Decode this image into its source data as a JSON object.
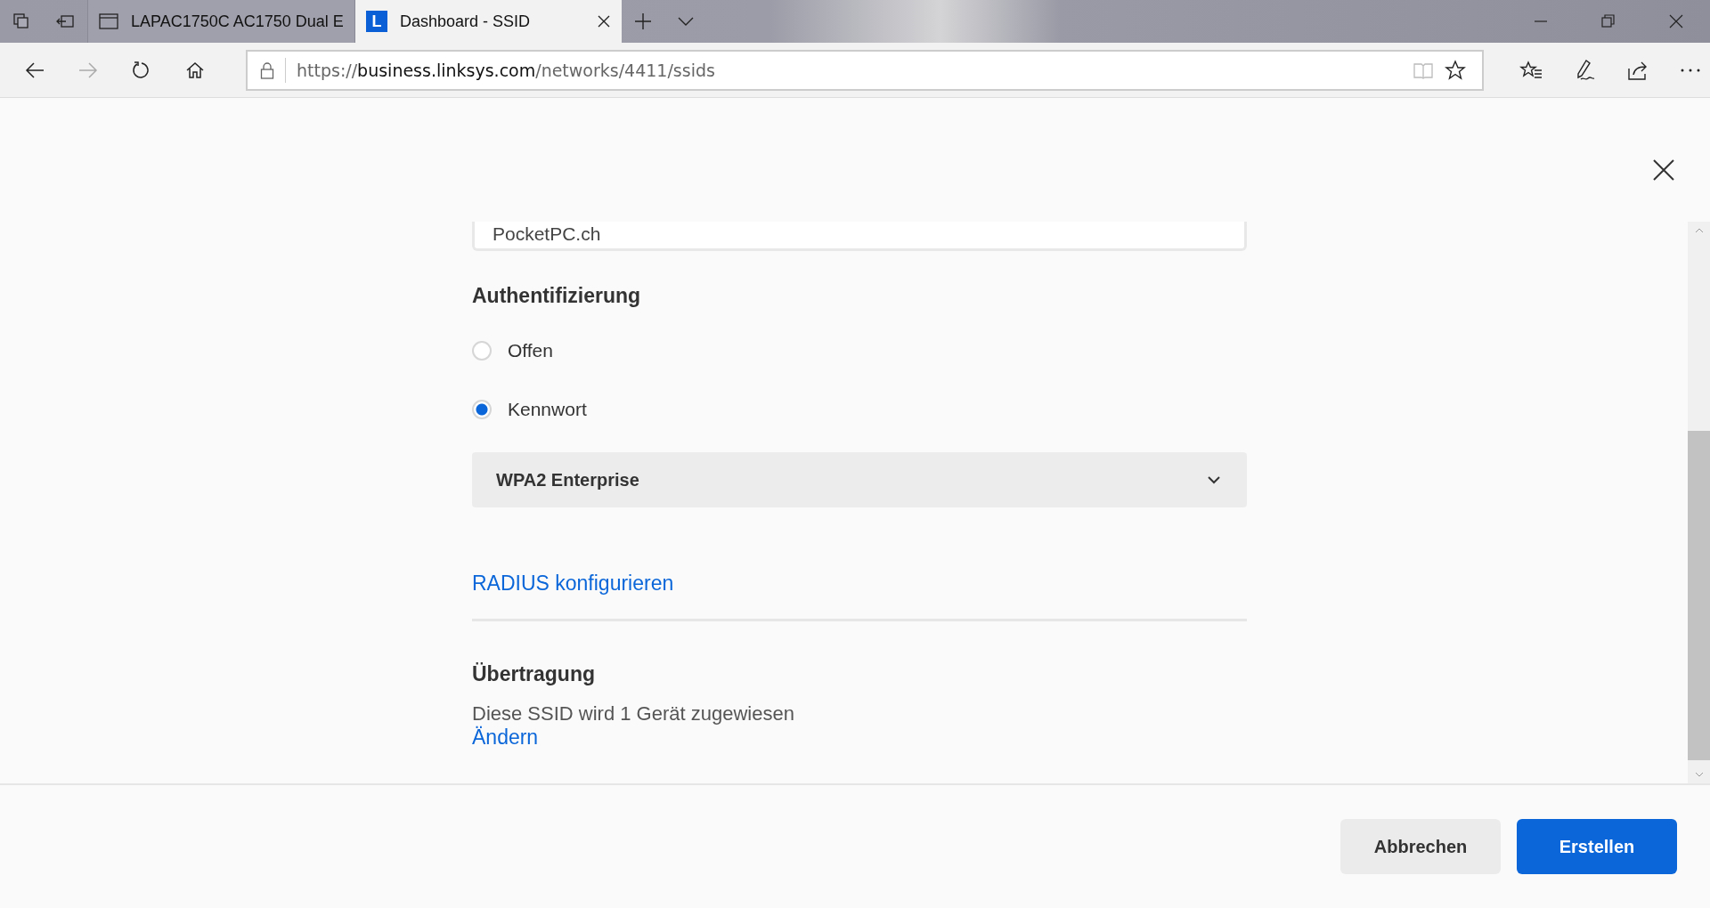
{
  "browser": {
    "tabs": [
      {
        "title": "LAPAC1750C AC1750 Dual E",
        "selected": false,
        "kind": "window"
      },
      {
        "title": "Dashboard - SSID",
        "selected": true,
        "kind": "logo",
        "logo_letter": "L"
      }
    ],
    "url": {
      "scheme": "https://",
      "host": "business.linksys.com",
      "path": "/networks/4411/ssids"
    }
  },
  "dialog": {
    "ssid_field": {
      "value": "PocketPC.ch"
    },
    "authentication": {
      "heading": "Authentifizierung",
      "options": [
        {
          "label": "Offen",
          "selected": false
        },
        {
          "label": "Kennwort",
          "selected": true
        }
      ],
      "security_mode": "WPA2 Enterprise",
      "radius_link": "RADIUS konfigurieren"
    },
    "broadcast": {
      "heading": "Übertragung",
      "description": "Diese SSID wird 1 Gerät zugewiesen",
      "change_link": "Ändern"
    },
    "buttons": [
      {
        "label": "Abbrechen",
        "kind": "secondary"
      },
      {
        "label": "Erstellen",
        "kind": "primary"
      }
    ]
  }
}
